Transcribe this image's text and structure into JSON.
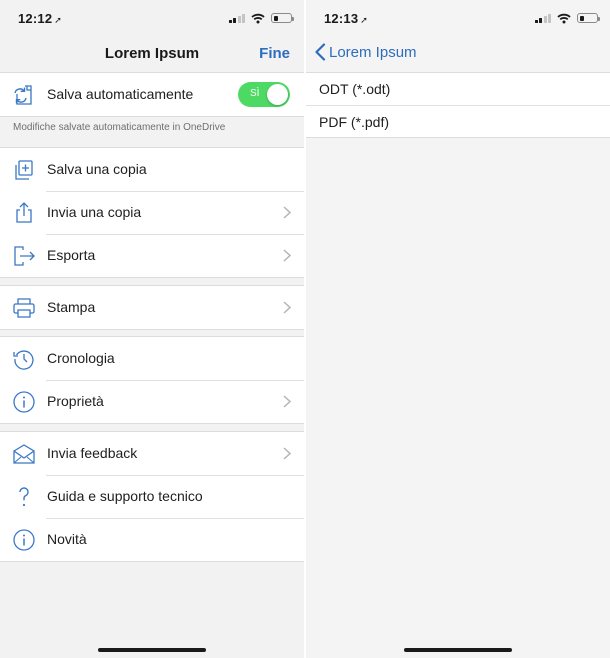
{
  "left": {
    "status": {
      "time": "12:12",
      "location_glyph": "➚"
    },
    "nav": {
      "title": "Lorem Ipsum",
      "done_label": "Fine"
    },
    "autosave": {
      "label": "Salva automaticamente",
      "toggle_label": "SÌ",
      "toggle_on": true,
      "accent": "#4cd964"
    },
    "footnote": "Modifiche salvate automaticamente in OneDrive",
    "groups": [
      {
        "items": [
          {
            "label": "Salva una copia",
            "icon": "add-copy-icon",
            "chevron": false
          },
          {
            "label": "Invia una copia",
            "icon": "share-icon",
            "chevron": true
          },
          {
            "label": "Esporta",
            "icon": "export-icon",
            "chevron": true
          }
        ]
      },
      {
        "items": [
          {
            "label": "Stampa",
            "icon": "printer-icon",
            "chevron": true
          }
        ]
      },
      {
        "items": [
          {
            "label": "Cronologia",
            "icon": "history-icon",
            "chevron": false
          },
          {
            "label": "Proprietà",
            "icon": "info-icon",
            "chevron": true
          }
        ]
      },
      {
        "items": [
          {
            "label": "Invia feedback",
            "icon": "feedback-mail-icon",
            "chevron": true
          },
          {
            "label": "Guida e supporto tecnico",
            "icon": "question-icon",
            "chevron": false
          },
          {
            "label": "Novità",
            "icon": "info-icon",
            "chevron": false
          }
        ]
      }
    ]
  },
  "right": {
    "status": {
      "time": "12:13",
      "location_glyph": "➚"
    },
    "nav": {
      "back_label": "Lorem Ipsum"
    },
    "formats": [
      {
        "label": "ODT (*.odt)"
      },
      {
        "label": "PDF (*.pdf)"
      }
    ]
  },
  "colors": {
    "link": "#2e6dbd",
    "icon": "#3a78c4"
  }
}
